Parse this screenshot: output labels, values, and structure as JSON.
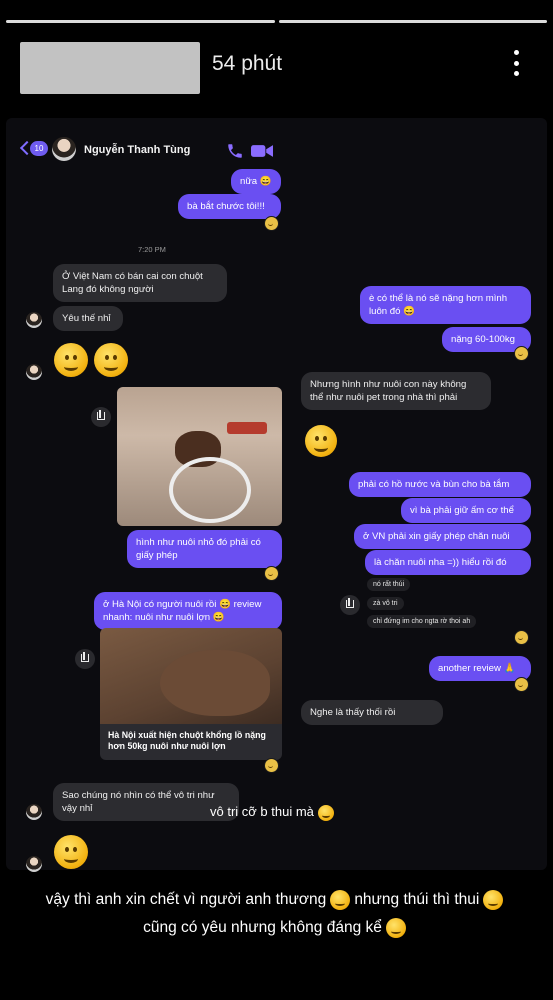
{
  "story": {
    "time": "54 phút"
  },
  "chat": {
    "back_badge": "10",
    "contact_name": "Nguyễn Thanh Tùng",
    "time_divider": "7:20 PM",
    "messages": [
      {
        "side": "me",
        "text": "nữa 😄"
      },
      {
        "side": "me",
        "text": "bà bắt chước tôi!!!"
      },
      {
        "side": "other",
        "text": "Ở Việt Nam có bán cai con chuột Lang đó không người"
      },
      {
        "side": "other",
        "text": "Yêu thế nhỉ"
      },
      {
        "side": "me",
        "text": "è có thể là nó sẽ nặng hơn mình luôn đó 😄"
      },
      {
        "side": "me",
        "text": "nặng 60-100kg"
      },
      {
        "side": "other",
        "text": "Nhưng hình như nuôi con này không thể như nuôi pet trong nhà thì phải"
      },
      {
        "side": "me",
        "text": "hình như nuôi nhỏ đó phải có giấy phép"
      },
      {
        "side": "me",
        "text": "phải có hồ nước và bùn cho bà tắm"
      },
      {
        "side": "me",
        "text": "vì bà phải giữ ấm cơ thể"
      },
      {
        "side": "me",
        "text": "ở VN phải xin giấy phép chăn nuôi"
      },
      {
        "side": "me",
        "text": "là chăn nuôi nha =)) hiểu rồi đó"
      },
      {
        "side": "other",
        "text": "nó rất thúi"
      },
      {
        "side": "other",
        "text": "zà vô tri"
      },
      {
        "side": "other",
        "text": "chỉ đứng im cho ngta rờ thoi ah"
      },
      {
        "side": "me",
        "text": "ở Hà Nội có người nuôi rồi 😄 review nhanh: nuôi như nuôi lợn 😄"
      },
      {
        "side": "me",
        "text": "another review 🙏"
      },
      {
        "side": "other",
        "text": "Nghe là thấy thối rồi"
      },
      {
        "side": "other",
        "text": "Sao chúng nó nhìn có thể vô tri như vậy nhỉ"
      }
    ],
    "link_card": {
      "title": "Hà Nội xuất hiện chuột khổng lồ nặng hơn 50kg nuôi như nuôi lợn"
    }
  },
  "captions": {
    "vo_tri": "vô tri cỡ b thui mà",
    "line1_a": "vậy thì anh xin chết vì người anh thương",
    "line1_b": "nhưng thúi thì thui",
    "line2": "cũng có yêu nhưng không đáng kể"
  },
  "colors": {
    "accent": "#6a4ff2",
    "bubble_other": "#2c2c30",
    "background": "#000000"
  }
}
